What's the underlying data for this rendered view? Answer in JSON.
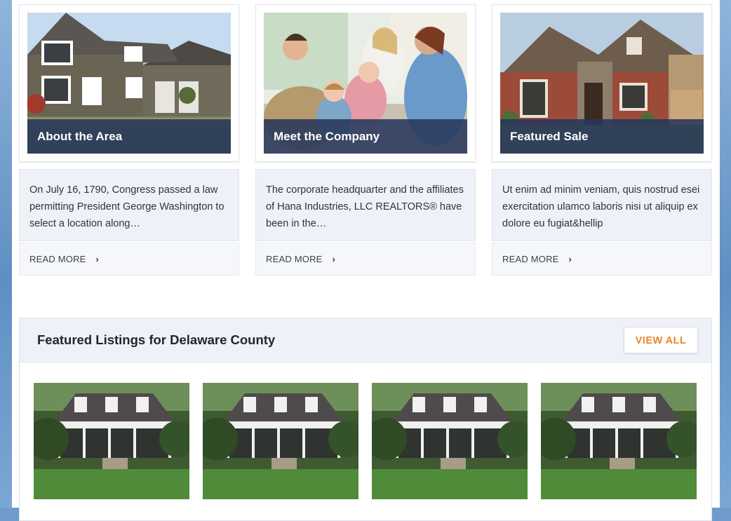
{
  "cards": [
    {
      "caption": "About the Area",
      "excerpt": "On July 16, 1790, Congress passed a law permitting President George Washington to select a location along…",
      "more": "READ MORE",
      "chevron": "›"
    },
    {
      "caption": "Meet the Company",
      "excerpt": "The corporate headquarter and the affiliates of Hana Industries, LLC REALTORS® have been in the…",
      "more": "READ MORE",
      "chevron": "›"
    },
    {
      "caption": "Featured Sale",
      "excerpt": "Ut enim ad minim veniam, quis nostrud esei exercitation ulamco laboris nisi ut aliquip ex dolore eu fugiat&hellip",
      "more": "READ MORE",
      "chevron": "›"
    }
  ],
  "listings": {
    "title": "Featured Listings for Delaware County",
    "view_all": "VIEW ALL"
  },
  "colors": {
    "caption_overlay": "#28375a",
    "accent": "#e8872a",
    "body_bg": "#eef1f7"
  }
}
